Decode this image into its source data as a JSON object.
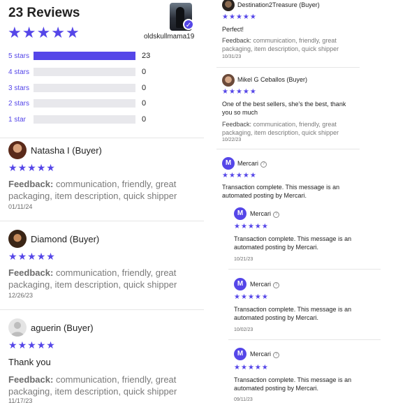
{
  "summary": {
    "title": "23 Reviews",
    "seller_name": "oldskullmama19",
    "rating": 5
  },
  "distribution": [
    {
      "label": "5 stars",
      "count": "23",
      "fraction": 1.0
    },
    {
      "label": "4 stars",
      "count": "0",
      "fraction": 0
    },
    {
      "label": "3 stars",
      "count": "0",
      "fraction": 0
    },
    {
      "label": "2 stars",
      "count": "0",
      "fraction": 0
    },
    {
      "label": "1 star",
      "count": "0",
      "fraction": 0
    }
  ],
  "feedback_label": "Feedback:",
  "left_reviews": [
    {
      "name": "Natasha I (Buyer)",
      "feedback": "communication, friendly, great packaging, item description, quick shipper",
      "date": "01/11/24"
    },
    {
      "name": "Diamond (Buyer)",
      "feedback": "communication, friendly, great packaging, item description, quick shipper",
      "date": "12/26/23"
    },
    {
      "name": "aguerin (Buyer)",
      "comment": "Thank you",
      "feedback": "communication, friendly, great packaging, item description, quick shipper",
      "date": "11/17/23"
    }
  ],
  "right_reviews": [
    {
      "name": "Destination2Treasure (Buyer)",
      "comment": "Perfect!",
      "feedback": "communication, friendly, great packaging, item description, quick shipper",
      "date": "10/31/23"
    },
    {
      "name": "Mikel G Ceballos (Buyer)",
      "comment": "One of the best sellers, she's the best, thank you so much",
      "feedback": "communication, friendly, great packaging, item description, quick shipper",
      "date": "10/22/23"
    }
  ],
  "mercari_posts": [
    {
      "name": "Mercari",
      "text": "Transaction complete. This message is an automated posting by Mercari.",
      "date": ""
    },
    {
      "name": "Mercari",
      "text": "Transaction complete. This message is an automated posting by Mercari.",
      "date": "10/21/23"
    },
    {
      "name": "Mercari",
      "text": "Transaction complete. This message is an automated posting by Mercari.",
      "date": "10/02/23"
    },
    {
      "name": "Mercari",
      "text": "Transaction complete. This message is an automated posting by Mercari.",
      "date": "09/11/23"
    }
  ],
  "icons": {
    "star": "star-icon",
    "verified": "verified-check-icon",
    "help": "question-circle-icon",
    "mercari": "mercari-logo-icon"
  },
  "colors": {
    "accent": "#5546e8",
    "bar_empty": "#e8e8ec",
    "muted_text": "#7a7a7a"
  }
}
